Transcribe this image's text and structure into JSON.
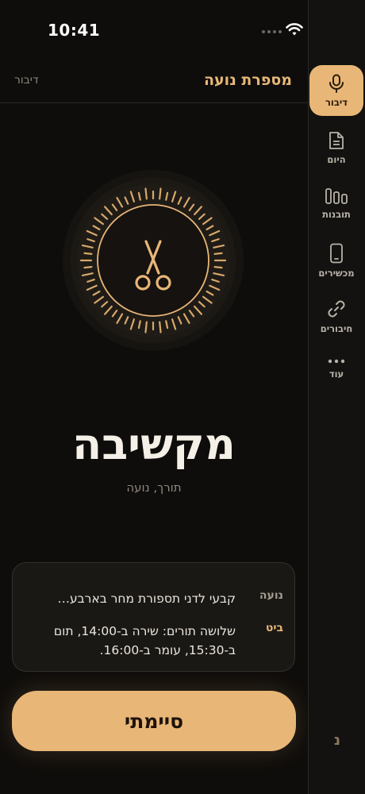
{
  "status": {
    "time": "10:41"
  },
  "header": {
    "title": "מספרת נועה",
    "subtitle": "דיבור"
  },
  "sidebar": {
    "items": [
      {
        "label": "דיבור",
        "icon": "microphone-icon",
        "active": true
      },
      {
        "label": "היום",
        "icon": "document-icon",
        "active": false
      },
      {
        "label": "תובנות",
        "icon": "bars-icon",
        "active": false
      },
      {
        "label": "מכשירים",
        "icon": "phone-icon",
        "active": false
      },
      {
        "label": "חיבורים",
        "icon": "link-icon",
        "active": false
      },
      {
        "label": "עוד",
        "icon": "more-icon",
        "active": false
      }
    ],
    "bottom_badge": "נ"
  },
  "listening": {
    "title": "מקשיבה",
    "subtitle": "תורך, נועה"
  },
  "transcript": [
    {
      "speaker": "נועה",
      "text": "קבעי לדני תספורת מחר בארבע…"
    },
    {
      "speaker": "ביט",
      "text": "שלושה תורים: שירה ב-14:00, תום ב-15:30, עומר ב-16:00."
    }
  ],
  "done_button": "סיימתי",
  "colors": {
    "accent": "#e8b677",
    "background": "#0f0d0b",
    "sidebar": "#131210"
  }
}
